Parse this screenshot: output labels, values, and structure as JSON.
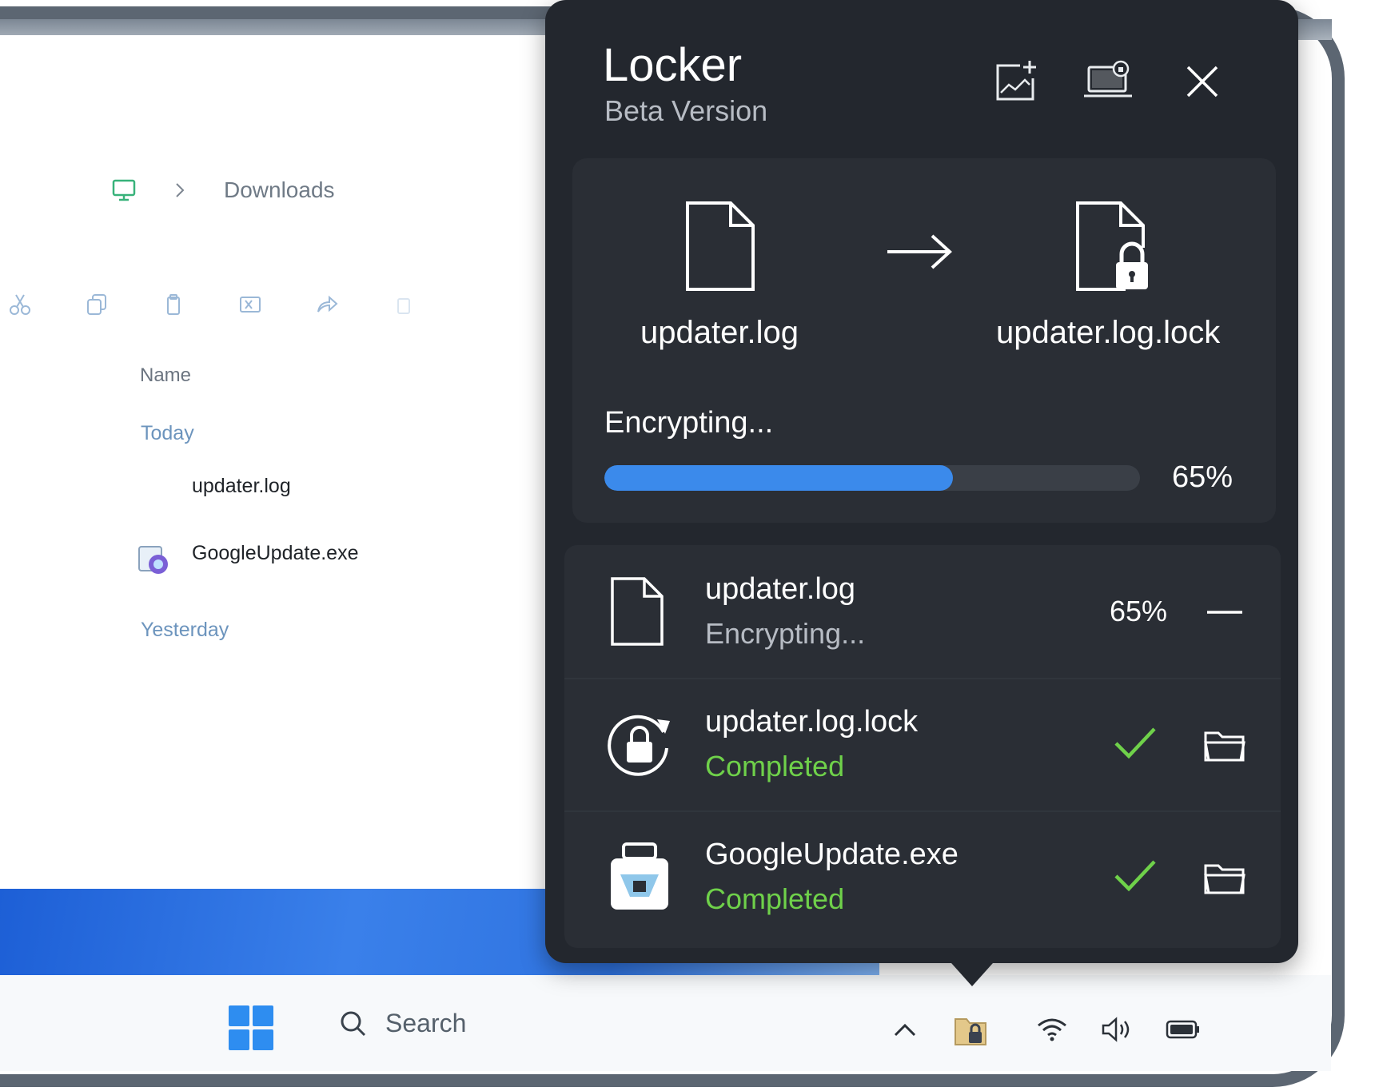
{
  "explorer": {
    "breadcrumb": {
      "icon": "monitor-icon",
      "folder": "Downloads"
    },
    "toolbar": [
      "cut-icon",
      "copy-icon",
      "paste-icon",
      "rename-icon",
      "share-icon",
      "delete-icon"
    ],
    "column_header": "Name",
    "groups": [
      {
        "label": "Today",
        "files": [
          "updater.log",
          "GoogleUpdate.exe"
        ]
      },
      {
        "label": "Yesterday",
        "files": []
      }
    ]
  },
  "taskbar": {
    "search_placeholder": "Search",
    "tray_icons": [
      "chevron-up-icon",
      "locker-tray-icon",
      "wifi-icon",
      "volume-icon",
      "battery-icon"
    ]
  },
  "locker": {
    "title": "Locker",
    "subtitle": "Beta Version",
    "header_buttons": [
      "add-image-icon",
      "laptop-lock-icon",
      "close-icon"
    ],
    "current": {
      "source_file": "updater.log",
      "target_file": "updater.log.lock",
      "status": "Encrypting...",
      "progress_percent": 65,
      "progress_label": "65%"
    },
    "queue": [
      {
        "name": "updater.log",
        "status": "Encrypting...",
        "state": "in-progress",
        "percent_label": "65%",
        "icon": "file-icon",
        "action": "minimize-icon"
      },
      {
        "name": "updater.log.lock",
        "status": "Completed",
        "state": "done",
        "icon": "lock-refresh-icon",
        "action": "open-folder-icon"
      },
      {
        "name": "GoogleUpdate.exe",
        "status": "Completed",
        "state": "done",
        "icon": "installer-icon",
        "action": "open-folder-icon"
      }
    ],
    "colors": {
      "panel": "#23272e",
      "accent": "#3b8aeb",
      "completed": "#6fd14a"
    }
  }
}
